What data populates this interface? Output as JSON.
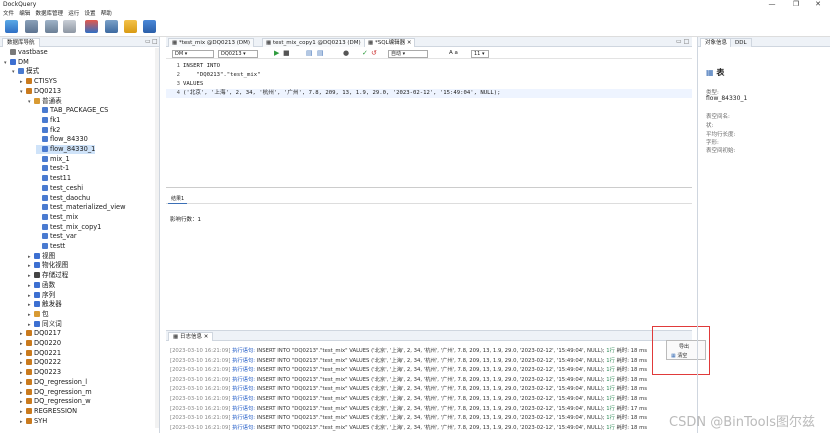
{
  "window": {
    "title": "DockQuery",
    "controls": [
      "—",
      "❐",
      "✕"
    ]
  },
  "menu": [
    "文件",
    "编辑",
    "数据库管理",
    "运行",
    "设置",
    "帮助"
  ],
  "left_panel": {
    "tab": "数据库导航",
    "tree": [
      {
        "label": "vastbase",
        "level": 0,
        "icon_color": "#7a7a7a",
        "toggle": ""
      },
      {
        "label": "DM",
        "level": 0,
        "icon_color": "#3c6fd1",
        "toggle": "v"
      },
      {
        "label": "模式",
        "level": 1,
        "icon_color": "#4a7bd0",
        "toggle": "v"
      },
      {
        "label": "CTISYS",
        "level": 2,
        "icon_color": "#c97a1e",
        "toggle": ">"
      },
      {
        "label": "DQ0213",
        "level": 2,
        "icon_color": "#c97a1e",
        "toggle": "v"
      },
      {
        "label": "普通表",
        "level": 3,
        "icon_color": "#d89a32",
        "toggle": "v"
      },
      {
        "label": "TAB_PACKAGE_CS",
        "level": 4,
        "icon_color": "#4a7bd0",
        "toggle": ""
      },
      {
        "label": "fk1",
        "level": 4,
        "icon_color": "#4a7bd0",
        "toggle": ""
      },
      {
        "label": "fk2",
        "level": 4,
        "icon_color": "#4a7bd0",
        "toggle": ""
      },
      {
        "label": "flow_84330",
        "level": 4,
        "icon_color": "#4a7bd0",
        "toggle": ""
      },
      {
        "label": "flow_84330_1",
        "level": 4,
        "icon_color": "#4a7bd0",
        "toggle": "",
        "selected": true
      },
      {
        "label": "mix_1",
        "level": 4,
        "icon_color": "#4a7bd0",
        "toggle": ""
      },
      {
        "label": "test-1",
        "level": 4,
        "icon_color": "#4a7bd0",
        "toggle": ""
      },
      {
        "label": "test11",
        "level": 4,
        "icon_color": "#4a7bd0",
        "toggle": ""
      },
      {
        "label": "test_ceshi",
        "level": 4,
        "icon_color": "#4a7bd0",
        "toggle": ""
      },
      {
        "label": "test_daochu",
        "level": 4,
        "icon_color": "#4a7bd0",
        "toggle": ""
      },
      {
        "label": "test_materialized_view",
        "level": 4,
        "icon_color": "#4a7bd0",
        "toggle": ""
      },
      {
        "label": "test_mix",
        "level": 4,
        "icon_color": "#4a7bd0",
        "toggle": ""
      },
      {
        "label": "test_mix_copy1",
        "level": 4,
        "icon_color": "#4a7bd0",
        "toggle": ""
      },
      {
        "label": "test_var",
        "level": 4,
        "icon_color": "#4a7bd0",
        "toggle": ""
      },
      {
        "label": "testt",
        "level": 4,
        "icon_color": "#4a7bd0",
        "toggle": ""
      },
      {
        "label": "视图",
        "level": 3,
        "icon_color": "#3c6fd1",
        "toggle": ">"
      },
      {
        "label": "物化视图",
        "level": 3,
        "icon_color": "#3c6fd1",
        "toggle": ">"
      },
      {
        "label": "存储过程",
        "level": 3,
        "icon_color": "#444",
        "toggle": ">"
      },
      {
        "label": "函数",
        "level": 3,
        "icon_color": "#3c6fd1",
        "toggle": ">"
      },
      {
        "label": "序列",
        "level": 3,
        "icon_color": "#3c6fd1",
        "toggle": ">"
      },
      {
        "label": "触发器",
        "level": 3,
        "icon_color": "#3c6fd1",
        "toggle": ">"
      },
      {
        "label": "包",
        "level": 3,
        "icon_color": "#d89a32",
        "toggle": ">"
      },
      {
        "label": "同义词",
        "level": 3,
        "icon_color": "#3c6fd1",
        "toggle": ">"
      },
      {
        "label": "DQ0217",
        "level": 2,
        "icon_color": "#c97a1e",
        "toggle": ">"
      },
      {
        "label": "DQ0220",
        "level": 2,
        "icon_color": "#c97a1e",
        "toggle": ">"
      },
      {
        "label": "DQ0221",
        "level": 2,
        "icon_color": "#c97a1e",
        "toggle": ">"
      },
      {
        "label": "DQ0222",
        "level": 2,
        "icon_color": "#c97a1e",
        "toggle": ">"
      },
      {
        "label": "DQ0223",
        "level": 2,
        "icon_color": "#c97a1e",
        "toggle": ">"
      },
      {
        "label": "DQ_regression_l",
        "level": 2,
        "icon_color": "#c97a1e",
        "toggle": ">"
      },
      {
        "label": "DQ_regression_m",
        "level": 2,
        "icon_color": "#c97a1e",
        "toggle": ">"
      },
      {
        "label": "DQ_regression_w",
        "level": 2,
        "icon_color": "#c97a1e",
        "toggle": ">"
      },
      {
        "label": "REGRESSION",
        "level": 2,
        "icon_color": "#c97a1e",
        "toggle": ">"
      },
      {
        "label": "SYH",
        "level": 2,
        "icon_color": "#c97a1e",
        "toggle": ">"
      }
    ]
  },
  "editor": {
    "tabs": [
      {
        "label": "*test_mix @DQ0213 (DM)",
        "active": false
      },
      {
        "label": "test_mix_copy1 @DQ0213 (DM)",
        "active": false
      },
      {
        "label": "*SQL编辑器",
        "active": true
      }
    ],
    "connection": "DM",
    "schema": "DQ0213",
    "commit_mode": "自动",
    "font_size": "11",
    "font_label": "A a",
    "lines": [
      "INSERT INTO",
      "    \"DQ0213\".\"test_mix\"",
      "VALUES",
      "('北京', '上海', 2, 34, '杭州', '广州', 7.8, 209, 13, 1.9, 29.0, '2023-02-12', '15:49:04', NULL);"
    ],
    "result_tab": "结果1",
    "result_text": "影响行数：1"
  },
  "log": {
    "tab": "日志信息",
    "rows": [
      {
        "ts": "[2023-03-10 16:21:09]",
        "label": "执行语句:",
        "sql": "INSERT INTO \"DQ0213\".\"test_mix\" VALUES ('北京', '上海', 2, 34, '杭州', '广州', 7.8, 209, 13, 1.9, 29.0, '2023-02-12', '15:49:04', NULL);",
        "cnt": "1行",
        "time": "耗时: 18 ms"
      },
      {
        "ts": "[2023-03-10 16:21:09]",
        "label": "执行语句:",
        "sql": "INSERT INTO \"DQ0213\".\"test_mix\" VALUES ('北京', '上海', 2, 34, '杭州', '广州', 7.8, 209, 13, 1.9, 29.0, '2023-02-12', '15:49:04', NULL);",
        "cnt": "1行",
        "time": "耗时: 18 ms"
      },
      {
        "ts": "[2023-03-10 16:21:09]",
        "label": "执行语句:",
        "sql": "INSERT INTO \"DQ0213\".\"test_mix\" VALUES ('北京', '上海', 2, 34, '杭州', '广州', 7.8, 209, 13, 1.9, 29.0, '2023-02-12', '15:49:04', NULL);",
        "cnt": "1行",
        "time": "耗时: 18 ms"
      },
      {
        "ts": "[2023-03-10 16:21:09]",
        "label": "执行语句:",
        "sql": "INSERT INTO \"DQ0213\".\"test_mix\" VALUES ('北京', '上海', 2, 34, '杭州', '广州', 7.8, 209, 13, 1.9, 29.0, '2023-02-12', '15:49:04', NULL);",
        "cnt": "1行",
        "time": "耗时: 18 ms"
      },
      {
        "ts": "[2023-03-10 16:21:09]",
        "label": "执行语句:",
        "sql": "INSERT INTO \"DQ0213\".\"test_mix\" VALUES ('北京', '上海', 2, 34, '杭州', '广州', 7.8, 209, 13, 1.9, 29.0, '2023-02-12', '15:49:04', NULL);",
        "cnt": "1行",
        "time": "耗时: 18 ms"
      },
      {
        "ts": "[2023-03-10 16:21:09]",
        "label": "执行语句:",
        "sql": "INSERT INTO \"DQ0213\".\"test_mix\" VALUES ('北京', '上海', 2, 34, '杭州', '广州', 7.8, 209, 13, 1.9, 29.0, '2023-02-12', '15:49:04', NULL);",
        "cnt": "1行",
        "time": "耗时: 18 ms"
      },
      {
        "ts": "[2023-03-10 16:21:09]",
        "label": "执行语句:",
        "sql": "INSERT INTO \"DQ0213\".\"test_mix\" VALUES ('北京', '上海', 2, 34, '杭州', '广州', 7.8, 209, 13, 1.9, 29.0, '2023-02-12', '15:49:04', NULL);",
        "cnt": "1行",
        "time": "耗时: 17 ms"
      },
      {
        "ts": "[2023-03-10 16:21:09]",
        "label": "执行语句:",
        "sql": "INSERT INTO \"DQ0213\".\"test_mix\" VALUES ('北京', '上海', 2, 34, '杭州', '广州', 7.8, 209, 13, 1.9, 29.0, '2023-02-12', '15:49:04', NULL);",
        "cnt": "1行",
        "time": "耗时: 18 ms"
      },
      {
        "ts": "[2023-03-10 16:21:09]",
        "label": "执行语句:",
        "sql": "INSERT INTO \"DQ0213\".\"test_mix\" VALUES ('北京', '上海', 2, 34, '杭州', '广州', 7.8, 209, 13, 1.9, 29.0, '2023-02-12', '15:49:04', NULL);",
        "cnt": "1行",
        "time": "耗时: 18 ms"
      }
    ],
    "context_menu": {
      "export": "导出",
      "clear": "清空"
    }
  },
  "right_panel": {
    "tabs": [
      "对象信息",
      "DDL"
    ],
    "title": "表",
    "object_type_label": "类型:",
    "object_name": "flow_84330_1",
    "fields": [
      "表空间名:",
      "状:",
      "平均行长度:",
      "字形:",
      "表空间初始:"
    ]
  },
  "watermark": "CSDN @BinTools图尔兹",
  "colors": {
    "accent": "#3b6fb6",
    "highlight_box": "#e03a3a",
    "selected_row": "#cfe3f9"
  }
}
